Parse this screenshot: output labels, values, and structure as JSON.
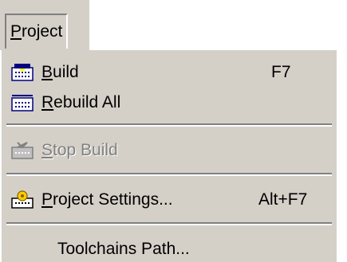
{
  "menubar": {
    "title_mnemonic": "P",
    "title_rest": "roject"
  },
  "menu": {
    "build": {
      "icon": "build-icon",
      "mnemonic": "B",
      "rest": "uild",
      "shortcut": "F7"
    },
    "rebuild_all": {
      "icon": "rebuild-all-icon",
      "mnemonic": "R",
      "rest": "ebuild All"
    },
    "stop_build": {
      "icon": "stop-build-icon",
      "mnemonic": "S",
      "rest": "top Build",
      "state": "disabled"
    },
    "project_settings": {
      "icon": "project-settings-icon",
      "mnemonic": "P",
      "rest": "roject Settings...",
      "shortcut": "Alt+F7"
    },
    "toolchains_path": {
      "label": "Toolchains Path..."
    }
  },
  "colors": {
    "menu_face": "#d4d0c8",
    "shadow": "#808080",
    "highlight": "#ffffff",
    "text": "#000000"
  }
}
